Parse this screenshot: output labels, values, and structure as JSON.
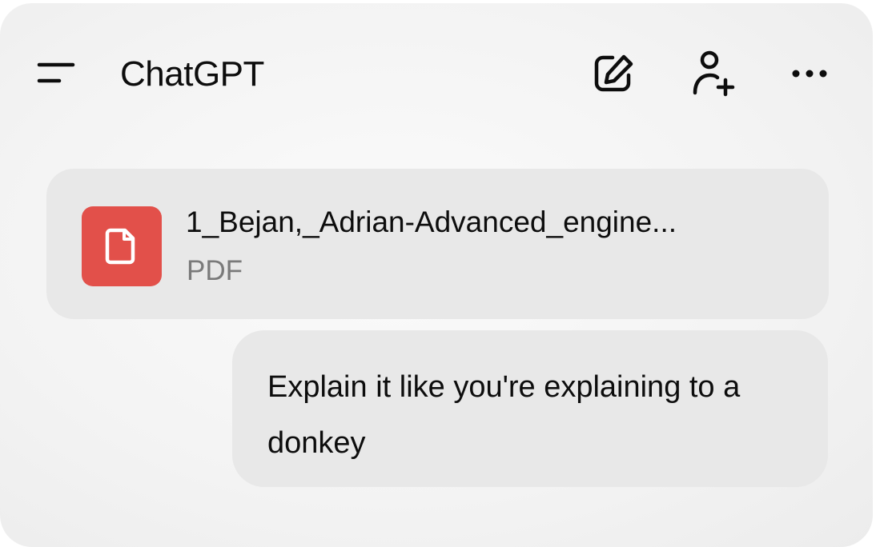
{
  "header": {
    "title": "ChatGPT",
    "icons": {
      "menu": "menu-icon",
      "new_chat": "edit-icon",
      "add_user": "add-user-icon",
      "more": "more-icon"
    }
  },
  "attachment": {
    "name": "1_Bejan,_Adrian-Advanced_engine...",
    "type": "PDF",
    "icon": "document-icon",
    "badge_color": "#e2504a"
  },
  "message": {
    "text": "Explain it like you're explaining to a donkey"
  }
}
